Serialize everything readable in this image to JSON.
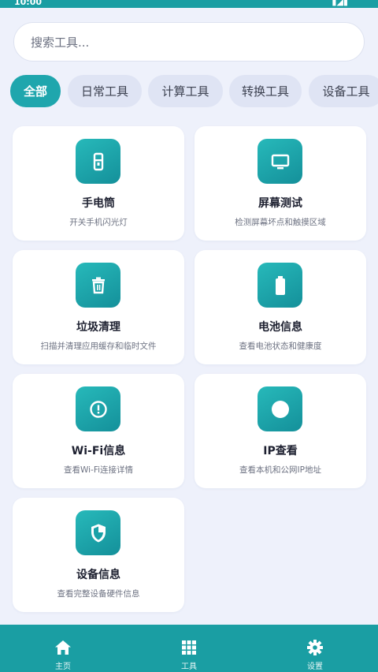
{
  "status": {
    "time": "10:00",
    "signal": "▮◢▮"
  },
  "search": {
    "placeholder": "搜索工具..."
  },
  "categories": [
    {
      "label": "全部",
      "active": true
    },
    {
      "label": "日常工具",
      "active": false
    },
    {
      "label": "计算工具",
      "active": false
    },
    {
      "label": "转换工具",
      "active": false
    },
    {
      "label": "设备工具",
      "active": false
    }
  ],
  "tools": [
    {
      "icon": "flashlight-icon",
      "title": "手电筒",
      "desc": "开关手机闪光灯"
    },
    {
      "icon": "monitor-icon",
      "title": "屏幕测试",
      "desc": "检测屏幕坏点和触摸区域"
    },
    {
      "icon": "trash-icon",
      "title": "垃圾清理",
      "desc": "扫描并清理应用缓存和临时文件"
    },
    {
      "icon": "battery-icon",
      "title": "电池信息",
      "desc": "查看电池状态和健康度"
    },
    {
      "icon": "info-icon",
      "title": "Wi-Fi信息",
      "desc": "查看Wi-Fi连接详情"
    },
    {
      "icon": "circle-icon",
      "title": "IP查看",
      "desc": "查看本机和公网IP地址"
    },
    {
      "icon": "shield-icon",
      "title": "设备信息",
      "desc": "查看完整设备硬件信息"
    }
  ],
  "nav": [
    {
      "icon": "home-icon",
      "label": "主页"
    },
    {
      "icon": "grid-icon",
      "label": "工具"
    },
    {
      "icon": "gear-icon",
      "label": "设置"
    }
  ],
  "colors": {
    "accent": "#1fa6ad",
    "nav_bg": "#1a9ea3",
    "page_bg": "#eef1fb"
  }
}
